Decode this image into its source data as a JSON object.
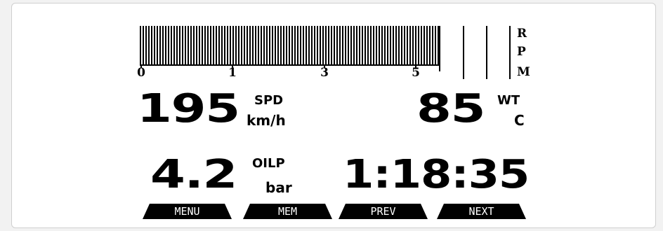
{
  "tachometer": {
    "scale_labels": [
      "0",
      "1",
      "3",
      "5"
    ],
    "unit_letters": [
      "R",
      "P",
      "M"
    ],
    "bar_color": "#000000"
  },
  "speed": {
    "value": "195",
    "label": "SPD",
    "unit": "km/h"
  },
  "water_temp": {
    "value": "85",
    "label": "WT",
    "unit": "C"
  },
  "oil_pressure": {
    "value": "4.2",
    "label": "OILP",
    "unit": "bar"
  },
  "lap_time": {
    "value": "1:18:35"
  },
  "softkeys": [
    "MENU",
    "MEM",
    "PREV",
    "NEXT"
  ]
}
